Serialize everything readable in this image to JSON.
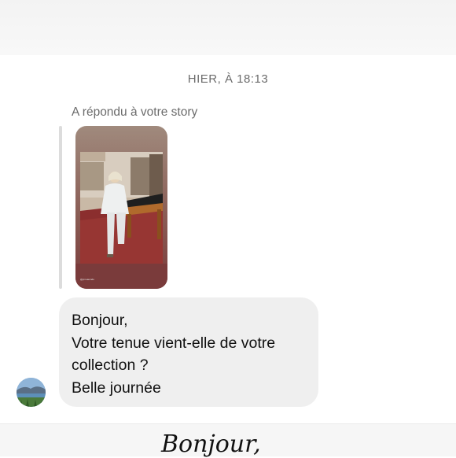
{
  "thread": {
    "timestamp": "HIER, À 18:13",
    "reply_label": "A répondu à votre story"
  },
  "story": {
    "image_caption": "@ymoaumdo"
  },
  "message": {
    "lines": [
      "Bonjour,",
      "Votre tenue vient-elle de votre",
      "collection ?",
      "Belle journée"
    ]
  },
  "bottom": {
    "text": "Bonjour,"
  },
  "colors": {
    "bubble": "#efefef",
    "secondary_text": "#6c6c6c",
    "story_background": "#8a5d55"
  },
  "icons": {
    "avatar": "profile-avatar-landscape"
  }
}
